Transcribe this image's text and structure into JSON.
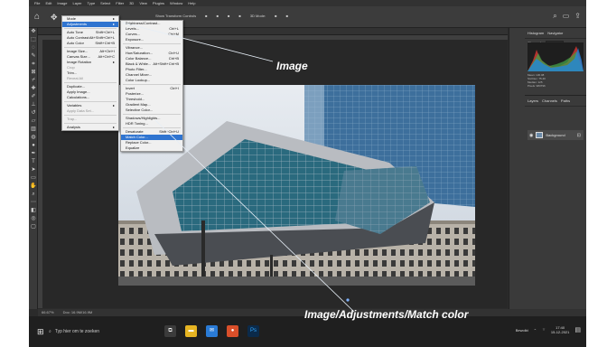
{
  "menubar": [
    "File",
    "Edit",
    "Image",
    "Layer",
    "Type",
    "Select",
    "Filter",
    "3D",
    "View",
    "Plugins",
    "Window",
    "Help"
  ],
  "options_bar": {
    "items": [
      "Show Transform Controls",
      "■",
      "■",
      "■",
      "■",
      "3D Mode:",
      "■",
      "■"
    ]
  },
  "image_menu": {
    "items": [
      {
        "label": "Mode",
        "shortcut": "▸",
        "state": "normal"
      },
      {
        "label": "Adjustments",
        "shortcut": "▸",
        "state": "highlight"
      },
      {
        "sep": true
      },
      {
        "label": "Auto Tone",
        "shortcut": "Shift+Ctrl+L",
        "state": "normal"
      },
      {
        "label": "Auto Contrast",
        "shortcut": "Alt+Shift+Ctrl+L",
        "state": "normal"
      },
      {
        "label": "Auto Color",
        "shortcut": "Shift+Ctrl+B",
        "state": "normal"
      },
      {
        "sep": true
      },
      {
        "label": "Image Size...",
        "shortcut": "Alt+Ctrl+I",
        "state": "normal"
      },
      {
        "label": "Canvas Size...",
        "shortcut": "Alt+Ctrl+C",
        "state": "normal"
      },
      {
        "label": "Image Rotation",
        "shortcut": "▸",
        "state": "normal"
      },
      {
        "label": "Crop",
        "shortcut": "",
        "state": "disabled"
      },
      {
        "label": "Trim...",
        "shortcut": "",
        "state": "normal"
      },
      {
        "label": "Reveal All",
        "shortcut": "",
        "state": "disabled"
      },
      {
        "sep": true
      },
      {
        "label": "Duplicate...",
        "shortcut": "",
        "state": "normal"
      },
      {
        "label": "Apply Image...",
        "shortcut": "",
        "state": "normal"
      },
      {
        "label": "Calculations...",
        "shortcut": "",
        "state": "normal"
      },
      {
        "sep": true
      },
      {
        "label": "Variables",
        "shortcut": "▸",
        "state": "normal"
      },
      {
        "label": "Apply Data Set...",
        "shortcut": "",
        "state": "disabled"
      },
      {
        "sep": true
      },
      {
        "label": "Trap...",
        "shortcut": "",
        "state": "disabled"
      },
      {
        "sep": true
      },
      {
        "label": "Analysis",
        "shortcut": "▸",
        "state": "normal"
      }
    ]
  },
  "adjustments_menu": {
    "items": [
      {
        "label": "Brightness/Contrast...",
        "shortcut": "",
        "state": "normal"
      },
      {
        "label": "Levels...",
        "shortcut": "Ctrl+L",
        "state": "normal"
      },
      {
        "label": "Curves...",
        "shortcut": "Ctrl+M",
        "state": "normal"
      },
      {
        "label": "Exposure...",
        "shortcut": "",
        "state": "normal"
      },
      {
        "sep": true
      },
      {
        "label": "Vibrance...",
        "shortcut": "",
        "state": "normal"
      },
      {
        "label": "Hue/Saturation...",
        "shortcut": "Ctrl+U",
        "state": "normal"
      },
      {
        "label": "Color Balance...",
        "shortcut": "Ctrl+B",
        "state": "normal"
      },
      {
        "label": "Black & White...",
        "shortcut": "Alt+Shift+Ctrl+B",
        "state": "normal"
      },
      {
        "label": "Photo Filter...",
        "shortcut": "",
        "state": "normal"
      },
      {
        "label": "Channel Mixer...",
        "shortcut": "",
        "state": "normal"
      },
      {
        "label": "Color Lookup...",
        "shortcut": "",
        "state": "normal"
      },
      {
        "sep": true
      },
      {
        "label": "Invert",
        "shortcut": "Ctrl+I",
        "state": "normal"
      },
      {
        "label": "Posterize...",
        "shortcut": "",
        "state": "normal"
      },
      {
        "label": "Threshold...",
        "shortcut": "",
        "state": "normal"
      },
      {
        "label": "Gradient Map...",
        "shortcut": "",
        "state": "normal"
      },
      {
        "label": "Selective Color...",
        "shortcut": "",
        "state": "normal"
      },
      {
        "sep": true
      },
      {
        "label": "Shadows/Highlights...",
        "shortcut": "",
        "state": "normal"
      },
      {
        "label": "HDR Toning...",
        "shortcut": "",
        "state": "normal"
      },
      {
        "sep": true
      },
      {
        "label": "Desaturate",
        "shortcut": "Shift+Ctrl+U",
        "state": "normal"
      },
      {
        "label": "Match Color...",
        "shortcut": "",
        "state": "highlight"
      },
      {
        "label": "Replace Color...",
        "shortcut": "",
        "state": "normal"
      },
      {
        "label": "Equalize",
        "shortcut": "",
        "state": "normal"
      }
    ]
  },
  "annotations": {
    "image_label": "Image",
    "path_label": "Image/Adjustments/Match color"
  },
  "histogram_panel": {
    "tabs": [
      "Histogram",
      "Navigator"
    ],
    "channel_label": "Channel:",
    "channel_value": "Colors",
    "stats": [
      "Mean: 130.08",
      "Std Dev: 75.40",
      "Median: 125",
      "Pixels: 983796"
    ]
  },
  "layers_panel": {
    "tabs": [
      "Layers",
      "Channels",
      "Paths"
    ],
    "layer_name": "Background"
  },
  "status_bar": {
    "zoom": "66.67%",
    "doc": "Doc: 16.9M/16.9M"
  },
  "taskbar": {
    "search_placeholder": "Typ hier om te zoeken",
    "weather": "Bewolkt",
    "time": "17:40",
    "date": "15-12-2021"
  },
  "colors": {
    "accent": "#2f74d0",
    "window_bg": "#2b2b2b",
    "panel_bg": "#3a3a3a"
  }
}
